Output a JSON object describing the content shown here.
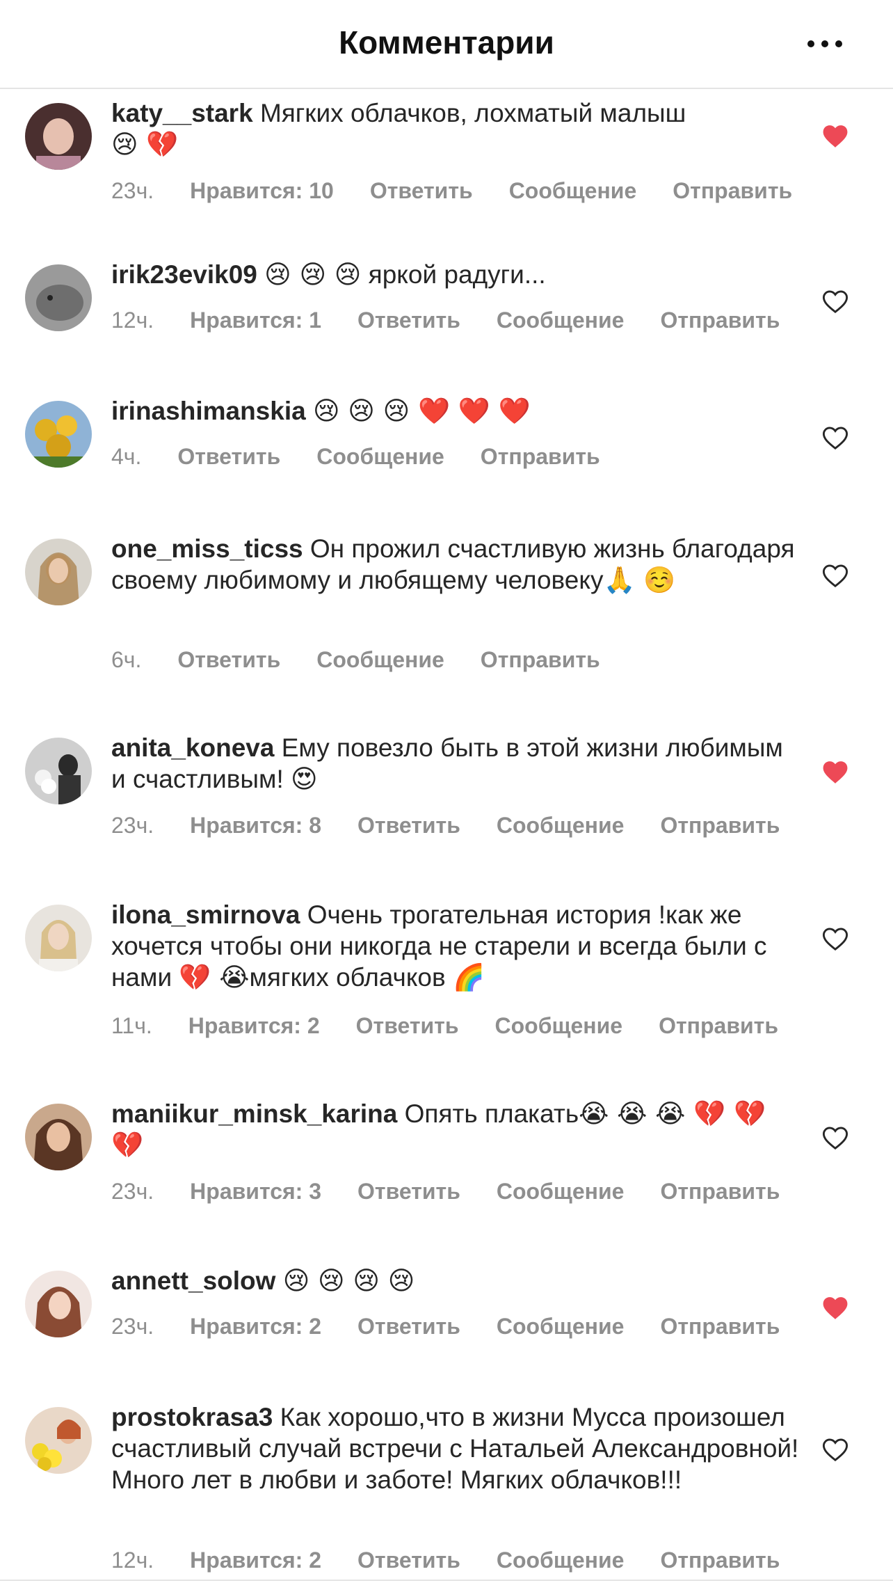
{
  "header": {
    "title": "Комментарии",
    "more_icon": "more-horizontal-icon"
  },
  "labels": {
    "reply": "Ответить",
    "message": "Сообщение",
    "send": "Отправить"
  },
  "colors": {
    "liked": "#ed4956",
    "meta": "#8e8e8e",
    "text": "#262626"
  },
  "comments": [
    {
      "username": "katy__stark",
      "text": "Мягких облачков, лохматый малыш",
      "emoji": "😢 💔",
      "time": "23ч.",
      "likes": "Нравится: 10",
      "liked": true
    },
    {
      "username": "irik23evik09",
      "text": "",
      "emoji": "😢 😢 😢",
      "text_after": "яркой радуги...",
      "time": "12ч.",
      "likes": "Нравится: 1",
      "liked": false
    },
    {
      "username": "irinashimanskia",
      "text": "",
      "emoji": "😢 😢 😢  ❤️ ❤️ ❤️",
      "time": "4ч.",
      "likes": "",
      "liked": false
    },
    {
      "username": "one_miss_ticss",
      "text": "Он прожил счастливую жизнь благодаря своему любимому и любящему человеку",
      "emoji": "🙏 ☺️",
      "time": "6ч.",
      "likes": "",
      "liked": false
    },
    {
      "username": "anita_koneva",
      "text": "Ему повезло быть в этой жизни любимым и счастливым!",
      "emoji": "😍",
      "time": "23ч.",
      "likes": "Нравится: 8",
      "liked": true
    },
    {
      "username": "ilona_smirnova",
      "text": "Очень трогательная история !как же хочется чтобы они никогда не старели и всегда были с нами",
      "emoji": "💔 😭",
      "text_after": "мягких облачков 🌈",
      "time": "11ч.",
      "likes": "Нравится: 2",
      "liked": false
    },
    {
      "username": "maniikur_minsk_karina",
      "text": "Опять плакать",
      "emoji": "😭 😭 😭 💔 💔 💔",
      "time": "23ч.",
      "likes": "Нравится: 3",
      "liked": false
    },
    {
      "username": "annett_solow",
      "text": "",
      "emoji": "😢 😢 😢 😢",
      "time": "23ч.",
      "likes": "Нравится: 2",
      "liked": true
    },
    {
      "username": "prostokrasa3",
      "text": "Как хорошо,что в жизни Мусса произошел счастливый случай встречи с Натальей Александровной! Много лет в любви и заботе! Мягких облачков!!!",
      "emoji": "",
      "time": "12ч.",
      "likes": "Нравится: 2",
      "liked": false
    }
  ]
}
